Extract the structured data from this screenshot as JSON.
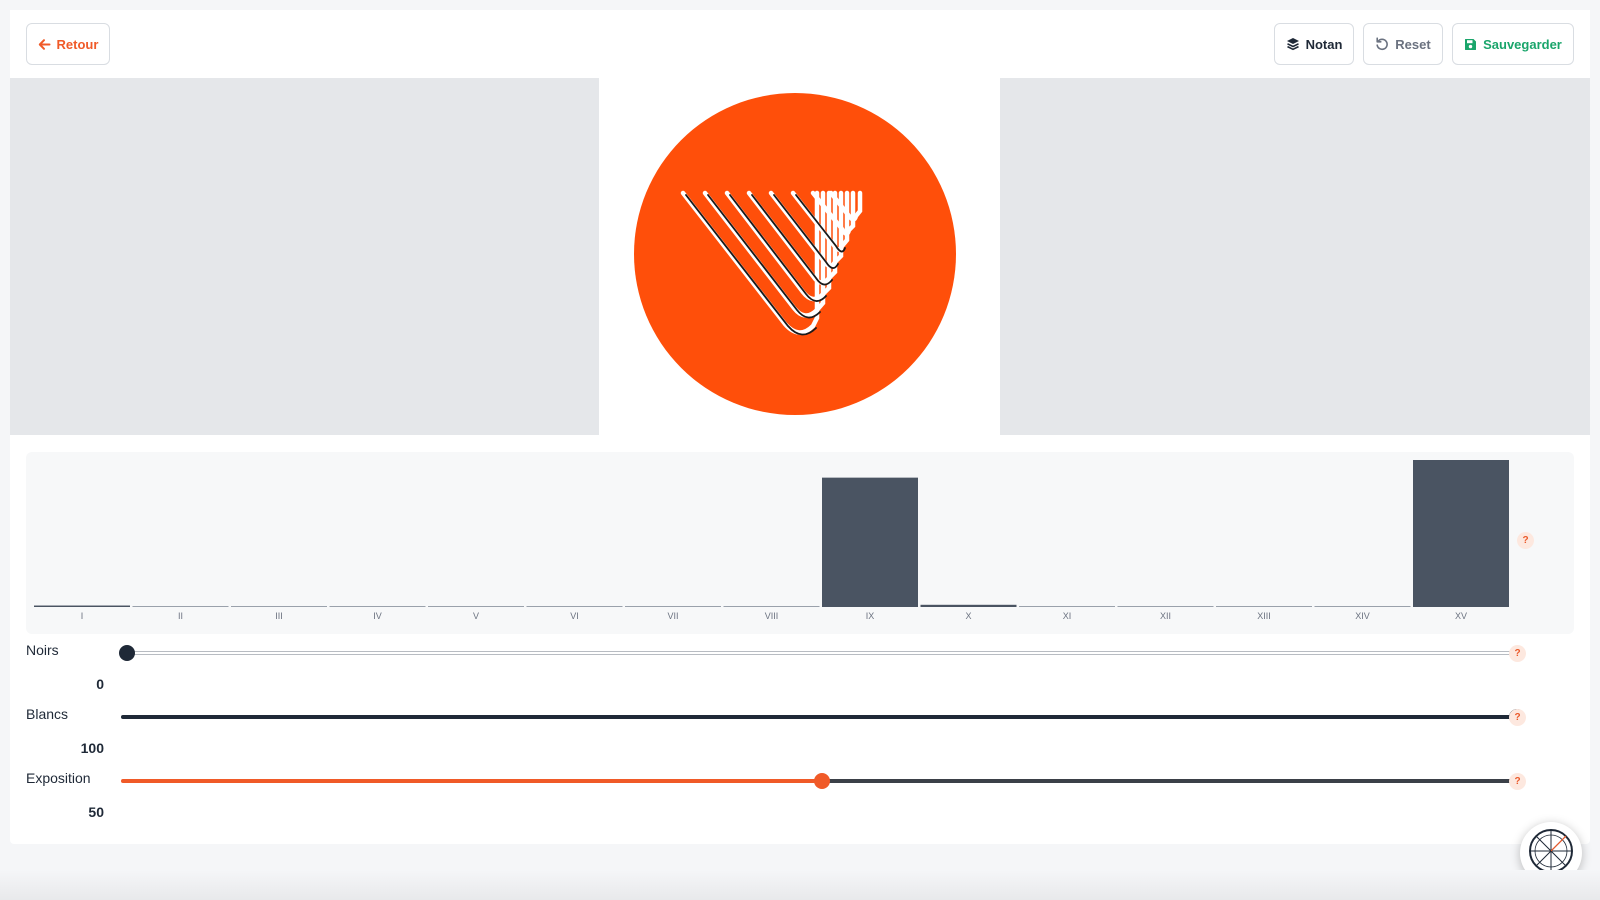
{
  "toolbar": {
    "back_label": "Retour",
    "notan_label": "Notan",
    "reset_label": "Reset",
    "save_label": "Sauvegarder"
  },
  "colors": {
    "accent": "#f05a28",
    "save": "#1aa56b",
    "dark": "#1f2937",
    "bar": "#4a5462",
    "logo_orange": "#ff4f0a"
  },
  "icons": {
    "back": "arrow-left-icon",
    "notan": "layers-icon",
    "reset": "undo-icon",
    "save": "floppy-disk-icon",
    "fab": "color-wheel-icon"
  },
  "chart_data": {
    "type": "bar",
    "categories": [
      "I",
      "II",
      "III",
      "IV",
      "V",
      "VI",
      "VII",
      "VIII",
      "IX",
      "X",
      "XI",
      "XII",
      "XIII",
      "XIV",
      "XV"
    ],
    "values": [
      1,
      0.3,
      0.3,
      0.3,
      0.3,
      0.3,
      0.3,
      0.3,
      88,
      1.5,
      0.3,
      0.3,
      0.3,
      0.5,
      100
    ],
    "ylim": [
      0,
      100
    ],
    "help_label": "?"
  },
  "sliders": [
    {
      "label": "Noirs",
      "value": "0",
      "level": 0,
      "help": "?"
    },
    {
      "label": "Blancs",
      "value": "100",
      "level": 100,
      "help": "?"
    },
    {
      "label": "Exposition",
      "value": "50",
      "level": 50,
      "help": "?"
    }
  ]
}
